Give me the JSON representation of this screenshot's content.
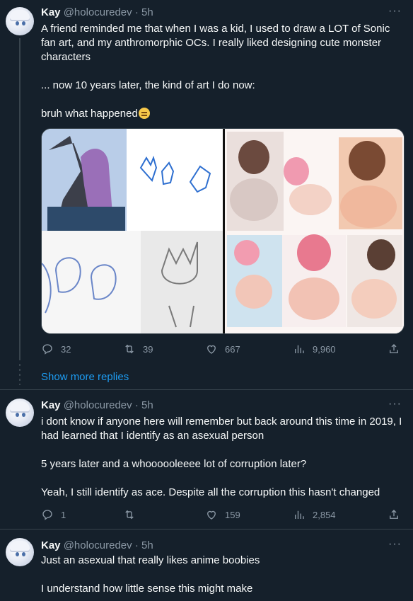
{
  "tweets": [
    {
      "name": "Kay",
      "handle": "@holocuredev",
      "dot": "·",
      "time": "5h",
      "more": "···",
      "lines": [
        "A friend reminded me that when I was a kid, I used to draw a LOT of Sonic fan art, and my anthromorphic OCs. I really liked designing cute monster characters",
        "... now 10 years later, the kind of art I do now:",
        "bruh what happened"
      ],
      "emoji": "relieved-face",
      "media": {
        "left_label": "childhood sketches",
        "right_label": "current anime art"
      },
      "replies": "32",
      "retweets": "39",
      "likes": "667",
      "views": "9,960"
    },
    {
      "name": "Kay",
      "handle": "@holocuredev",
      "dot": "·",
      "time": "5h",
      "more": "···",
      "lines": [
        "i dont know if anyone here will remember but back around this time in 2019, I had learned that I identify as an asexual person",
        "5 years later and a whoooooleeee lot of corruption later?",
        "Yeah, I still identify as ace. Despite all the corruption this hasn't changed"
      ],
      "replies": "1",
      "retweets": "",
      "likes": "159",
      "views": "2,854"
    },
    {
      "name": "Kay",
      "handle": "@holocuredev",
      "dot": "·",
      "time": "5h",
      "more": "···",
      "lines": [
        "Just an asexual that really likes anime boobies",
        "I understand how little sense this might make"
      ]
    }
  ],
  "show_more": "Show more replies",
  "icons": {
    "reply": "reply-icon",
    "retweet": "retweet-icon",
    "like": "like-icon",
    "views": "views-icon",
    "share": "share-icon"
  },
  "colors": {
    "background": "#15202b",
    "text": "#f7f9f9",
    "muted": "#8b98a5",
    "link": "#1d9bf0"
  }
}
